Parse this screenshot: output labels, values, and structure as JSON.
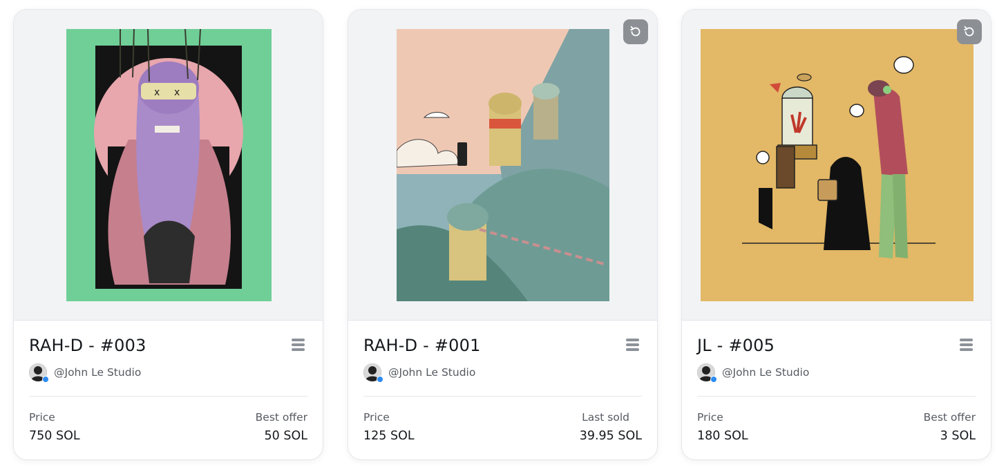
{
  "cards": [
    {
      "title": "RAH-D - #003",
      "creator": "@John Le Studio",
      "price_label": "Price",
      "price_value": "750 SOL",
      "secondary_label": "Best offer",
      "secondary_value": "50 SOL",
      "refresh_button": false,
      "art_background": "#6fcf97"
    },
    {
      "title": "RAH-D - #001",
      "creator": "@John Le Studio",
      "price_label": "Price",
      "price_value": "125 SOL",
      "secondary_label": "Last sold",
      "secondary_value": "39.95 SOL",
      "refresh_button": true,
      "art_background": "#efc8b4"
    },
    {
      "title": "JL - #005",
      "creator": "@John Le Studio",
      "price_label": "Price",
      "price_value": "180 SOL",
      "secondary_label": "Best offer",
      "secondary_value": "3 SOL",
      "refresh_button": true,
      "art_background": "#e3b866"
    }
  ],
  "icons": {
    "refresh": "refresh-icon",
    "menu": "menu-icon",
    "verified": "verified-badge-icon"
  },
  "colors": {
    "verified_badge": "#2d8cf0",
    "refresh_button": "#8c8f94"
  }
}
